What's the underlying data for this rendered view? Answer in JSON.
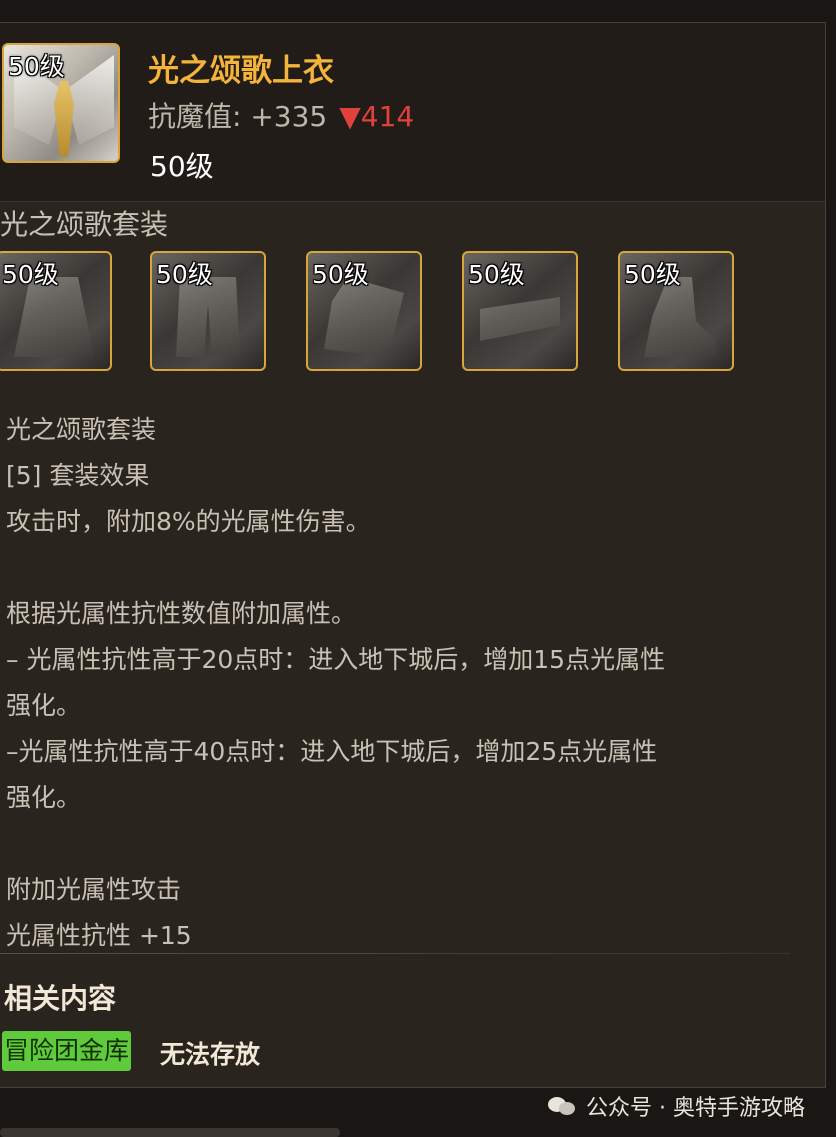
{
  "item": {
    "icon_level": "50级",
    "name": "光之颂歌上衣",
    "stat_label": "抗魔值:",
    "stat_value": "+335",
    "stat_compare": "▼414",
    "level": "50级"
  },
  "set": {
    "title": "光之颂歌套装",
    "pieces": [
      {
        "level": "50级",
        "icon": "coat-icon"
      },
      {
        "level": "50级",
        "icon": "pants-icon"
      },
      {
        "level": "50级",
        "icon": "shoulder-icon"
      },
      {
        "level": "50级",
        "icon": "belt-icon"
      },
      {
        "level": "50级",
        "icon": "shoes-icon"
      }
    ]
  },
  "description": {
    "lines": [
      "光之颂歌套装",
      "[5] 套装效果",
      "攻击时，附加8%的光属性伤害。",
      "",
      "根据光属性抗性数值附加属性。",
      "– 光属性抗性高于20点时：进入地下城后，增加15点光属性",
      "强化。",
      "–光属性抗性高于40点时：进入地下城后，增加25点光属性",
      "强化。",
      "",
      "附加光属性攻击",
      "光属性抗性 +15"
    ]
  },
  "related": {
    "title": "相关内容",
    "tag": "冒险团金库",
    "tag_text": "无法存放"
  },
  "watermark": {
    "text": "公众号 · 奥特手游攻略"
  },
  "colors": {
    "item_name": "#f4b43c",
    "frame_gold": "#d7a53c",
    "compare_red": "#e0413a",
    "tag_green": "#5fca3c"
  }
}
